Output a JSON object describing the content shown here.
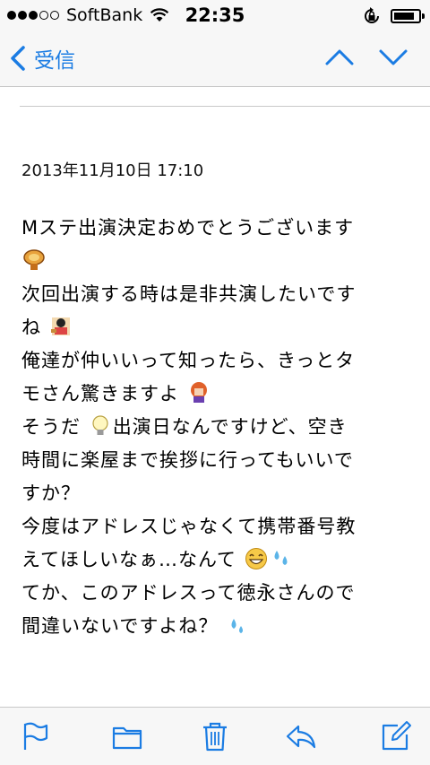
{
  "status_bar": {
    "carrier": "SoftBank",
    "time": "22:35",
    "signal_bars": 3,
    "signal_total": 5,
    "battery_level": 0.85
  },
  "nav": {
    "back_label": "受信",
    "accent_color": "#1b7ce3"
  },
  "message": {
    "date": "2013年11月10日 17:10",
    "lines": [
      "Mステ出演決定おめでとうございます",
      "",
      "次回出演する時は是非共演したいです",
      "ね",
      "俺達が仲いいって知ったら、きっとタ",
      "モさん驚きますよ",
      "そうだ",
      "出演日なんですけど、空き",
      "時間に楽屋まで挨拶に行ってもいいで",
      "すか？",
      "今度はアドレスじゃなくて携帯番号教",
      "えてほしいなぁ…なんて",
      "てか、このアドレスって徳永さんので",
      "間違いないですよね？"
    ]
  },
  "icons": {
    "flag": "flag-icon",
    "folder": "folder-icon",
    "trash": "trash-icon",
    "reply": "reply-icon",
    "compose": "compose-icon",
    "emoji_trophy": "trophy-emoji",
    "emoji_character1": "character-emoji",
    "emoji_character2": "girl-emoji",
    "emoji_bulb": "lightbulb-emoji",
    "emoji_smile": "smile-emoji",
    "emoji_sweat": "sweat-drops-emoji"
  }
}
